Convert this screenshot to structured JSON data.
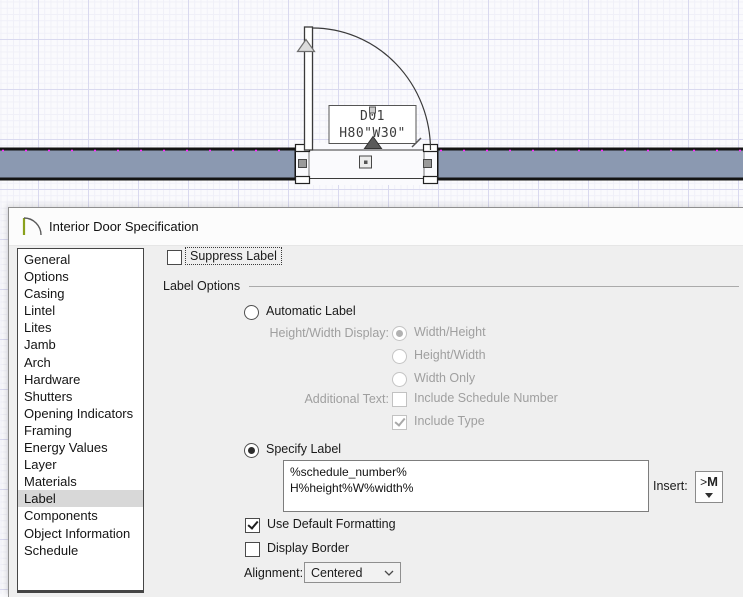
{
  "plan": {
    "door_label": {
      "line1": "D01",
      "line2": "H80\"W30\""
    },
    "colors": {
      "wall_fill": "#8b99b1",
      "grid_major": "#d9d9ef",
      "grid_minor": "#f0f0f8",
      "selection_magenta": "#ff2dff"
    }
  },
  "dialog": {
    "title": "Interior Door Specification",
    "sidebar": {
      "items": [
        {
          "label": "General",
          "selected": false
        },
        {
          "label": "Options",
          "selected": false
        },
        {
          "label": "Casing",
          "selected": false
        },
        {
          "label": "Lintel",
          "selected": false
        },
        {
          "label": "Lites",
          "selected": false
        },
        {
          "label": "Jamb",
          "selected": false
        },
        {
          "label": "Arch",
          "selected": false
        },
        {
          "label": "Hardware",
          "selected": false
        },
        {
          "label": "Shutters",
          "selected": false
        },
        {
          "label": "Opening Indicators",
          "selected": false
        },
        {
          "label": "Framing",
          "selected": false
        },
        {
          "label": "Energy Values",
          "selected": false
        },
        {
          "label": "Layer",
          "selected": false
        },
        {
          "label": "Materials",
          "selected": false
        },
        {
          "label": "Label",
          "selected": true
        },
        {
          "label": "Components",
          "selected": false
        },
        {
          "label": "Object Information",
          "selected": false
        },
        {
          "label": "Schedule",
          "selected": false
        }
      ]
    },
    "main": {
      "suppress_label": {
        "label": "Suppress Label",
        "checked": false
      },
      "group_title": "Label Options",
      "automatic_label": {
        "label": "Automatic Label",
        "selected": false
      },
      "height_width_display": {
        "label": "Height/Width Display:",
        "options": [
          {
            "label": "Width/Height",
            "selected": true
          },
          {
            "label": "Height/Width",
            "selected": false
          },
          {
            "label": "Width Only",
            "selected": false
          }
        ]
      },
      "additional_text": {
        "label": "Additional Text:",
        "options": [
          {
            "label": "Include Schedule Number",
            "checked": false
          },
          {
            "label": "Include Type",
            "checked": true
          }
        ]
      },
      "specify_label": {
        "label": "Specify Label",
        "selected": true
      },
      "label_textarea": {
        "value": "%schedule_number%\nH%height%W%width%"
      },
      "insert": {
        "label": "Insert:",
        "button_prefix": ">",
        "button_letter": "M"
      },
      "use_default_formatting": {
        "label": "Use Default Formatting",
        "checked": true
      },
      "display_border": {
        "label": "Display Border",
        "checked": false
      },
      "alignment": {
        "label": "Alignment:",
        "value": "Centered"
      }
    }
  }
}
